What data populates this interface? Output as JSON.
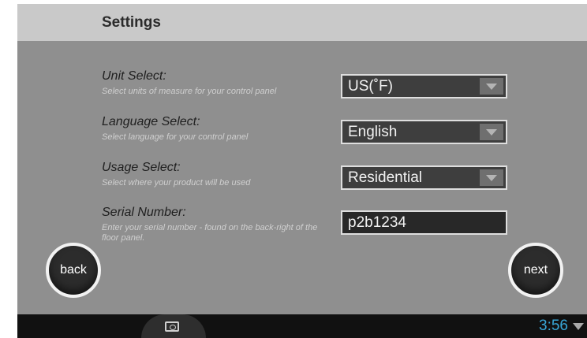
{
  "header": {
    "title": "Settings"
  },
  "settings": [
    {
      "label": "Unit Select:",
      "hint": "Select units of measure for your control panel",
      "value": "US(˚F)"
    },
    {
      "label": "Language Select:",
      "hint": "Select language for your control panel",
      "value": "English"
    },
    {
      "label": "Usage Select:",
      "hint": "Select where your product will be used",
      "value": "Residential"
    }
  ],
  "serial": {
    "label": "Serial Number:",
    "hint": "Enter your serial number - found on the back-right of the floor panel.",
    "value": "p2b1234"
  },
  "buttons": {
    "back": "back",
    "next": "next"
  },
  "statusbar": {
    "time": "3:56"
  },
  "icons": {
    "camera": "camera-icon",
    "wifi": "wifi-icon",
    "dropdown": "chevron-down-icon"
  },
  "colors": {
    "accent": "#38a6d6",
    "background": "#8f8f8f",
    "header": "#c9c9c9"
  }
}
